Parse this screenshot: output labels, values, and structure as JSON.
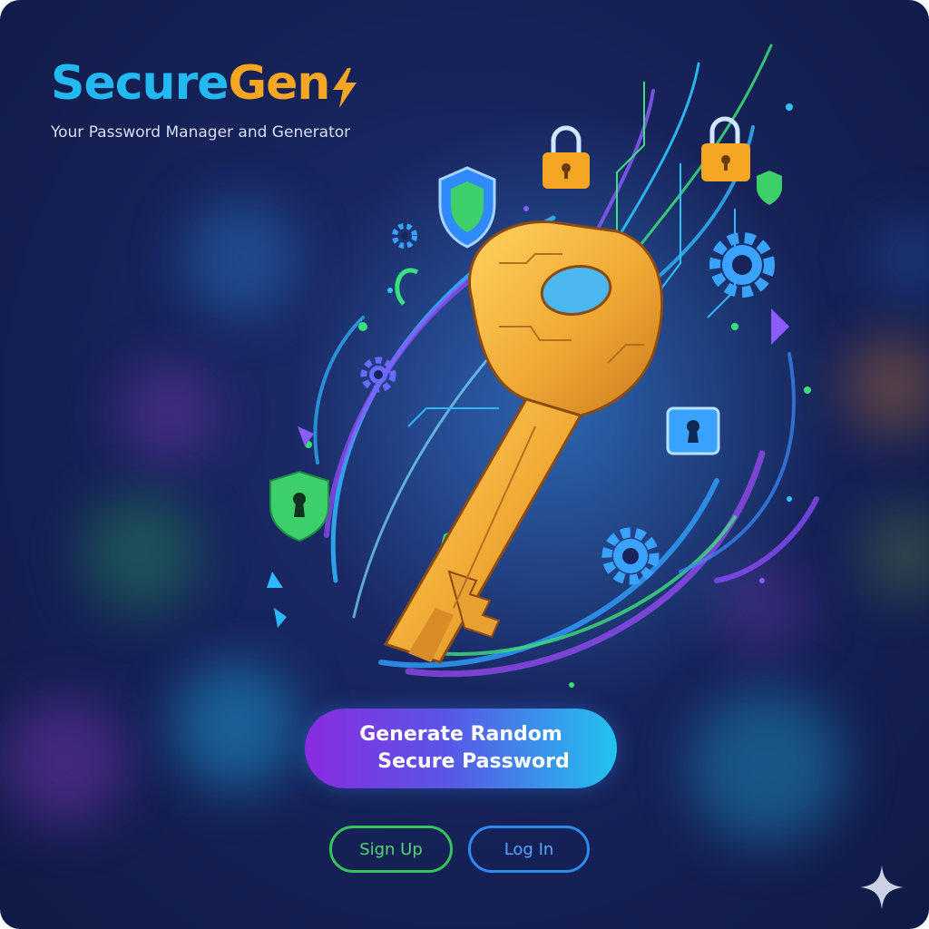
{
  "brand": {
    "name_part_1": "Secure",
    "name_part_2": "Gen",
    "icon": "lightning-bolt-icon",
    "tagline": "Your Password Manager and Generator"
  },
  "hero": {
    "illustration": "glowing-key-illustration",
    "icons": [
      "key-icon",
      "padlock-icon",
      "shield-icon",
      "gear-icon",
      "keyhole-icon"
    ]
  },
  "actions": {
    "generate_line_1": "Generate Random",
    "generate_line_2": "Secure Password",
    "signup_label": "Sign Up",
    "login_label": "Log In"
  },
  "corner": {
    "icon": "sparkle-icon"
  },
  "colors": {
    "background": "#17245c",
    "brand_cyan": "#22b8f0",
    "brand_orange": "#f5a623",
    "key_gold": "#f2b53a",
    "generate_gradient_start": "#8a2be2",
    "generate_gradient_end": "#21c3ee",
    "signup_green": "#34c45a",
    "login_blue": "#2c8bf0"
  }
}
